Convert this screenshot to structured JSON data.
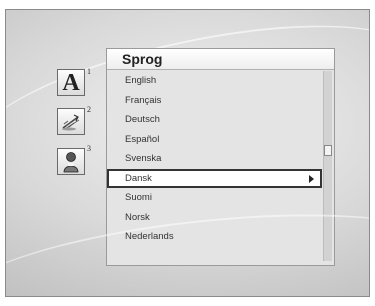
{
  "side_icons": [
    {
      "name": "font-a-icon",
      "glyph": "A",
      "number": "1"
    },
    {
      "name": "antenna-settings-icon",
      "number": "2"
    },
    {
      "name": "person-icon",
      "number": "3"
    }
  ],
  "menu": {
    "title": "Sprog",
    "items": [
      {
        "label": "English"
      },
      {
        "label": "Français"
      },
      {
        "label": "Deutsch"
      },
      {
        "label": "Español"
      },
      {
        "label": "Svenska"
      },
      {
        "label": "Dansk",
        "selected": true
      },
      {
        "label": "Suomi"
      },
      {
        "label": "Norsk"
      },
      {
        "label": "Nederlands"
      }
    ]
  }
}
